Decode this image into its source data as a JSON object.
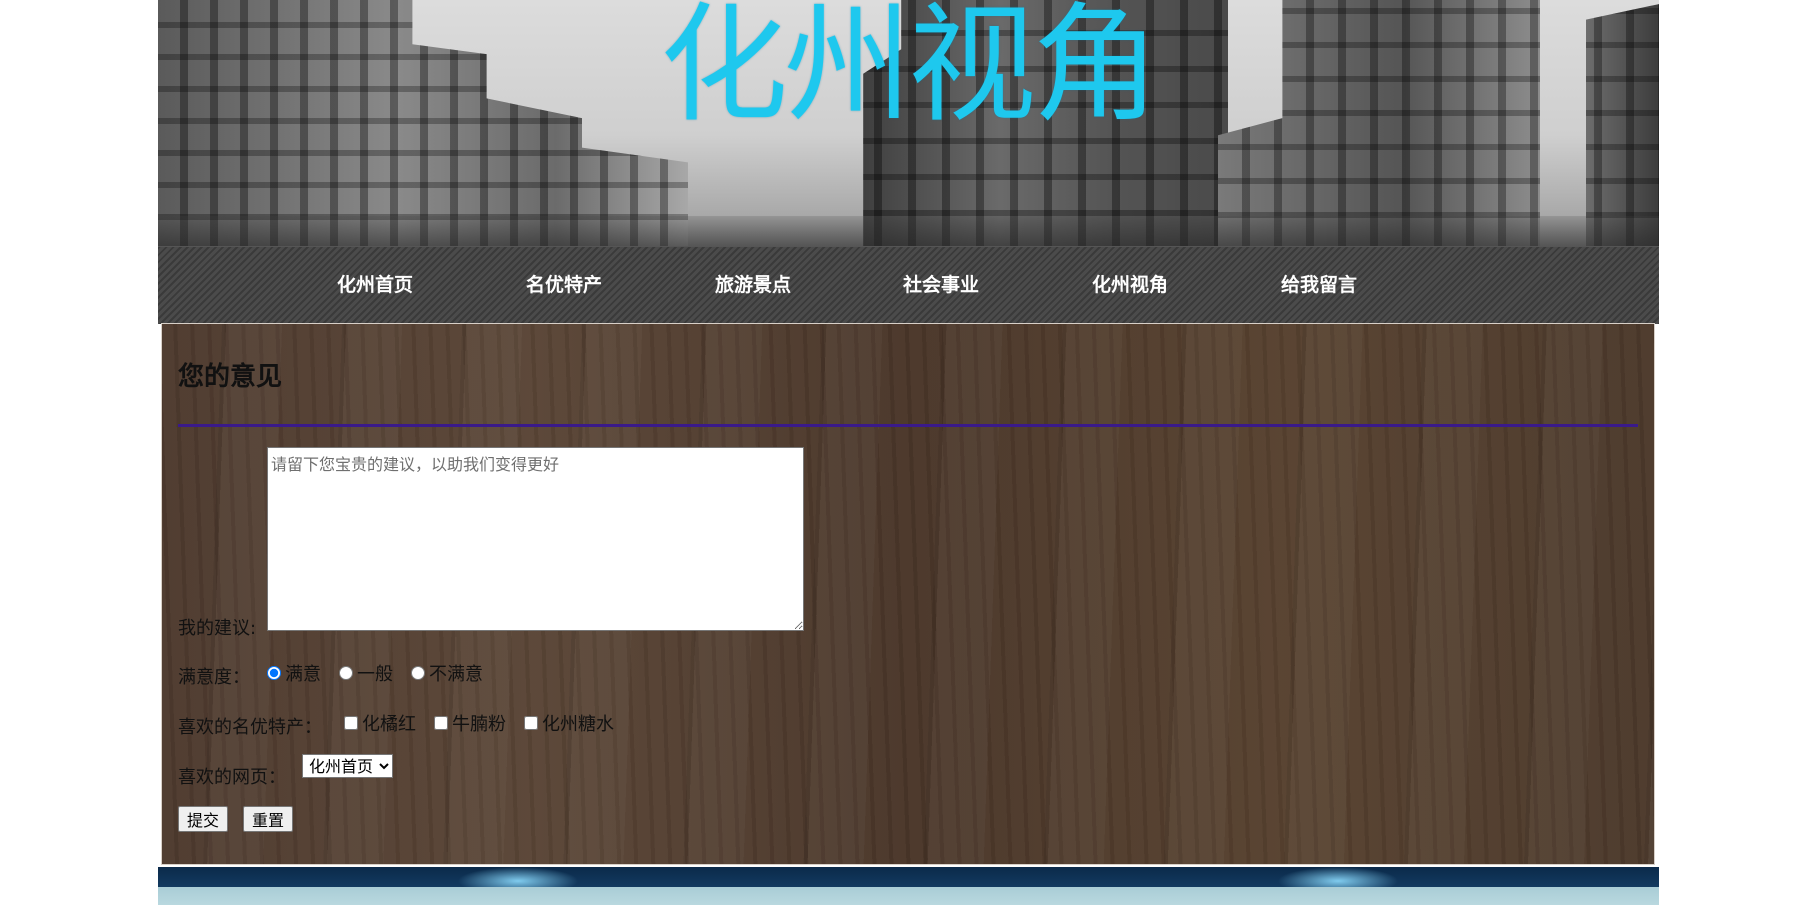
{
  "banner": {
    "title": "化州视角"
  },
  "nav": {
    "items": [
      {
        "label": "化州首页"
      },
      {
        "label": "名优特产"
      },
      {
        "label": "旅游景点"
      },
      {
        "label": "社会事业"
      },
      {
        "label": "化州视角"
      },
      {
        "label": "给我留言"
      }
    ]
  },
  "form": {
    "heading": "您的意见",
    "suggestion": {
      "label": "我的建议:",
      "placeholder": "请留下您宝贵的建议，以助我们变得更好",
      "value": ""
    },
    "satisfaction": {
      "label": "满意度：",
      "options": [
        "满意",
        "一般",
        "不满意"
      ],
      "selected": "满意"
    },
    "favorite_products": {
      "label": "喜欢的名优特产：",
      "options": [
        "化橘红",
        "牛腩粉",
        "化州糖水"
      ],
      "checked": []
    },
    "favorite_page": {
      "label": "喜欢的网页：",
      "selected": "化州首页"
    },
    "buttons": {
      "submit": "提交",
      "reset": "重置"
    }
  },
  "colors": {
    "title": "#1ec8ee",
    "nav_text": "#ffffff",
    "rule": "#3a1a8a",
    "panel": "#4e3a2e"
  }
}
